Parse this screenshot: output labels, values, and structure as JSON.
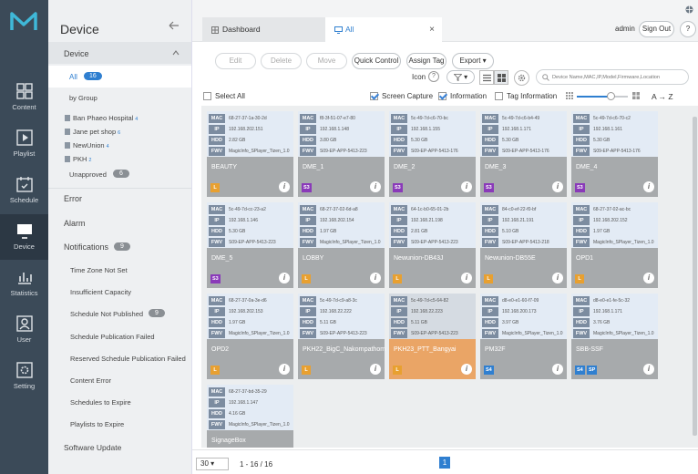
{
  "nav": {
    "items": [
      {
        "label": "Content",
        "icon": "content-icon"
      },
      {
        "label": "Playlist",
        "icon": "playlist-icon"
      },
      {
        "label": "Schedule",
        "icon": "schedule-icon"
      },
      {
        "label": "Device",
        "icon": "device-icon"
      },
      {
        "label": "Statistics",
        "icon": "statistics-icon"
      },
      {
        "label": "User",
        "icon": "user-icon"
      },
      {
        "label": "Setting",
        "icon": "setting-icon"
      }
    ]
  },
  "sidebar": {
    "title": "Device",
    "section": "Device",
    "all_label": "All",
    "all_count": "16",
    "by_group": "by Group",
    "groups": [
      {
        "label": "Ban Phaeo Hospital",
        "count": "4"
      },
      {
        "label": "Jane pet shop",
        "count": "6"
      },
      {
        "label": "NewUnion",
        "count": "4"
      },
      {
        "label": "PKH",
        "count": "2"
      }
    ],
    "unapproved": "Unapproved",
    "unapproved_count": "6",
    "error": "Error",
    "alarm": "Alarm",
    "notifications": "Notifications",
    "notifications_count": "9",
    "notif_items": [
      {
        "label": "Time Zone Not Set",
        "count": ""
      },
      {
        "label": "Insufficient Capacity",
        "count": ""
      },
      {
        "label": "Schedule Not Published",
        "count": "9"
      },
      {
        "label": "Schedule Publication Failed",
        "count": ""
      },
      {
        "label": "Reserved Schedule Publication Failed",
        "count": ""
      },
      {
        "label": "Content Error",
        "count": ""
      },
      {
        "label": "Schedules to Expire",
        "count": ""
      },
      {
        "label": "Playlists to Expire",
        "count": ""
      }
    ],
    "cut_item": "Software Update"
  },
  "header": {
    "tab_dashboard": "Dashboard",
    "tab_all": "All",
    "user": "admin",
    "signout": "Sign Out",
    "help": "?"
  },
  "toolbar": {
    "edit": "Edit",
    "delete": "Delete",
    "move": "Move",
    "quick_control": "Quick Control",
    "assign_tag": "Assign Tag",
    "export": "Export",
    "icon_label": "Icon",
    "search_placeholder": "Device Name,MAC,IP,Model,Firmware,Location"
  },
  "options": {
    "select_all": "Select All",
    "screen_capture": "Screen Capture",
    "information": "Information",
    "tag_information": "Tag Information",
    "sort": "A → Z"
  },
  "field_labels": {
    "mac": "MAC",
    "ip": "IP",
    "hdd": "HDD",
    "fwv": "FWV"
  },
  "devices": [
    {
      "mac": "68-27-37-1a-30-2d",
      "ip": "192.168.202.151",
      "hdd": "2.82 GB",
      "fwv": "MagicInfo_SPlayer_Tizen_1.0",
      "name": "BEAUTY",
      "badges": [
        {
          "t": "L",
          "c": "#e8a030"
        }
      ],
      "highlight": false
    },
    {
      "mac": "f8-3f-51-07-e7-80",
      "ip": "192.168.1.148",
      "hdd": "3.80 GB",
      "fwv": "S09-EP-APP-5413-223",
      "name": "DME_1",
      "badges": [
        {
          "t": "S3",
          "c": "#8a3ab9"
        }
      ],
      "highlight": false
    },
    {
      "mac": "5c-49-7d-c6-70-bc",
      "ip": "192.168.1.155",
      "hdd": "5.30 GB",
      "fwv": "S09-EP-APP-5413-176",
      "name": "DME_2",
      "badges": [
        {
          "t": "S3",
          "c": "#8a3ab9"
        }
      ],
      "highlight": false
    },
    {
      "mac": "5c-49-7d-c6-b4-49",
      "ip": "192.168.1.171",
      "hdd": "5.30 GB",
      "fwv": "S09-EP-APP-5413-176",
      "name": "DME_3",
      "badges": [
        {
          "t": "S3",
          "c": "#8a3ab9"
        }
      ],
      "highlight": false
    },
    {
      "mac": "5c-49-7d-c6-70-c2",
      "ip": "192.168.1.161",
      "hdd": "5.30 GB",
      "fwv": "S09-EP-APP-5413-176",
      "name": "DME_4",
      "badges": [
        {
          "t": "S3",
          "c": "#8a3ab9"
        }
      ],
      "highlight": false
    },
    {
      "mac": "5c-49-7d-cc-23-a2",
      "ip": "192.168.1.146",
      "hdd": "5.30 GB",
      "fwv": "S09-EP-APP-5413-223",
      "name": "DME_5",
      "badges": [
        {
          "t": "S3",
          "c": "#8a3ab9"
        }
      ],
      "highlight": false
    },
    {
      "mac": "68-27-37-02-6d-a8",
      "ip": "192.168.202.154",
      "hdd": "1.97 GB",
      "fwv": "MagicInfo_SPlayer_Tizen_1.0",
      "name": "LOBBY",
      "badges": [
        {
          "t": "L",
          "c": "#e8a030"
        }
      ],
      "highlight": false
    },
    {
      "mac": "64-1c-b0-65-01-2b",
      "ip": "192.168.21.198",
      "hdd": "2.81 GB",
      "fwv": "S09-EP-APP-5413-223",
      "name": "Newunion-DB43J",
      "badges": [
        {
          "t": "L",
          "c": "#e8a030"
        }
      ],
      "highlight": false
    },
    {
      "mac": "84-c0-ef-22-f0-bf",
      "ip": "192.168.21.191",
      "hdd": "5.10 GB",
      "fwv": "S09-EP-APP-5413-218",
      "name": "Newunion-DB55E",
      "badges": [
        {
          "t": "L",
          "c": "#e8a030"
        }
      ],
      "highlight": false
    },
    {
      "mac": "68-27-37-02-ac-bc",
      "ip": "192.168.202.152",
      "hdd": "1.97 GB",
      "fwv": "MagicInfo_SPlayer_Tizen_1.0",
      "name": "OPD1",
      "badges": [
        {
          "t": "L",
          "c": "#e8a030"
        }
      ],
      "highlight": false
    },
    {
      "mac": "68-27-37-0a-3e-d6",
      "ip": "192.168.202.153",
      "hdd": "1.97 GB",
      "fwv": "MagicInfo_SPlayer_Tizen_1.0",
      "name": "OPD2",
      "badges": [
        {
          "t": "L",
          "c": "#e8a030"
        }
      ],
      "highlight": false
    },
    {
      "mac": "5c-49-7d-c9-a8-3c",
      "ip": "192.168.22.222",
      "hdd": "5.11 GB",
      "fwv": "S09-EP-APP-5413-223",
      "name": "PKH22_BigC_Nakornpathom",
      "badges": [
        {
          "t": "L",
          "c": "#e8a030"
        }
      ],
      "highlight": false
    },
    {
      "mac": "5c-49-7d-c5-64-82",
      "ip": "192.168.22.223",
      "hdd": "5.11 GB",
      "fwv": "S09-EP-APP-5413-223",
      "name": "PKH23_PTT_Bangyai",
      "badges": [
        {
          "t": "L",
          "c": "#e8a030"
        }
      ],
      "highlight": true
    },
    {
      "mac": "d8-e0-e1-60-f7-09",
      "ip": "192.168.200.173",
      "hdd": "3.97 GB",
      "fwv": "MagicInfo_SPlayer_Tizen_1.0",
      "name": "PM32F",
      "badges": [
        {
          "t": "S4",
          "c": "#2f7fd0"
        }
      ],
      "highlight": false
    },
    {
      "mac": "d8-e0-e1-fe-5c-32",
      "ip": "192.168.1.171",
      "hdd": "3.76 GB",
      "fwv": "MagicInfo_SPlayer_Tizen_1.0",
      "name": "SBB-SSF",
      "badges": [
        {
          "t": "S4",
          "c": "#2f7fd0"
        },
        {
          "t": "SP",
          "c": "#2f7fd0"
        }
      ],
      "highlight": false
    },
    {
      "mac": "68-27-37-bd-35-29",
      "ip": "192.168.1.147",
      "hdd": "4.16 GB",
      "fwv": "MagicInfo_SPlayer_Tizen_1.0",
      "name": "SignageBox",
      "badges": [],
      "highlight": false
    }
  ],
  "footer": {
    "page_size": "30",
    "range": "1 - 16 / 16",
    "page": "1"
  },
  "colors": {
    "accent": "#2f7fd0",
    "nav_bg": "#3b4a58",
    "highlight_card": "#eaa566"
  }
}
